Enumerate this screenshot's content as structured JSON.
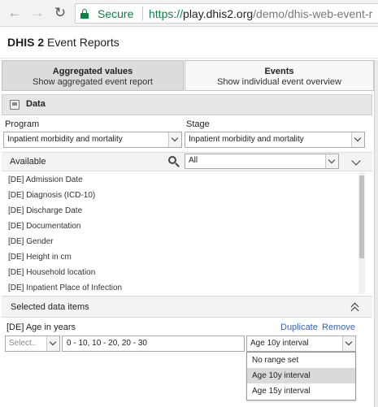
{
  "browser": {
    "secure_label": "Secure",
    "url_scheme": "https://",
    "url_host": "play.dhis2.org",
    "url_path": "/demo/dhis-web-event-r"
  },
  "app": {
    "title_bold": "DHIS 2",
    "title_rest": " Event Reports"
  },
  "tabs": [
    {
      "title": "Aggregated values",
      "subtitle": "Show aggregated event report",
      "active": true
    },
    {
      "title": "Events",
      "subtitle": "Show individual event overview",
      "active": false
    }
  ],
  "data_panel": {
    "title": "Data",
    "program_label": "Program",
    "program_value": "Inpatient morbidity and mortality",
    "stage_label": "Stage",
    "stage_value": "Inpatient morbidity and mortality",
    "available_label": "Available",
    "filter_value": "All",
    "available_items": [
      "[DE] Admission Date",
      "[DE] Diagnosis (ICD-10)",
      "[DE] Discharge Date",
      "[DE] Documentation",
      "[DE] Gender",
      "[DE] Height in cm",
      "[DE] Household location",
      "[DE] Inpatient Place of Infection"
    ],
    "selected_label": "Selected data items"
  },
  "selected_item": {
    "name": "[DE] Age in years",
    "duplicate_label": "Duplicate",
    "remove_label": "Remove",
    "operator_placeholder": "Select..",
    "range_value": "0 - 10, 10 - 20, 20 - 30",
    "legend_value": "Age 10y interval",
    "legend_options": [
      {
        "label": "No range set",
        "selected": false
      },
      {
        "label": "Age 10y interval",
        "selected": true
      },
      {
        "label": "Age 15y interval",
        "selected": false
      }
    ]
  },
  "colors": {
    "secure_green": "#0b8043",
    "link_blue": "#3162c5",
    "active_tab": "#dcdcdc"
  }
}
